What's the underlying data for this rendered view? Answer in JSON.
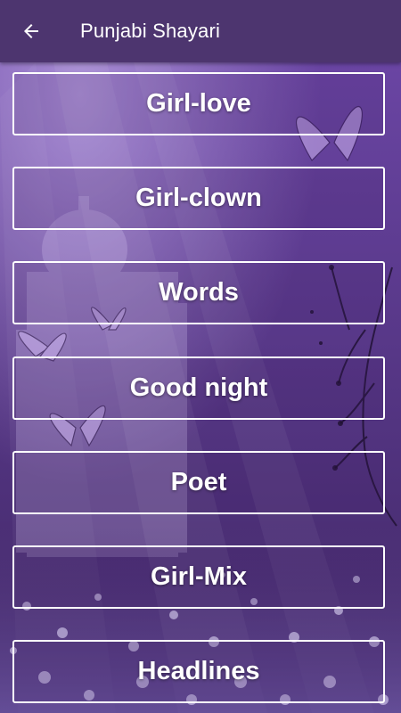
{
  "appbar": {
    "title": "Punjabi Shayari",
    "back_icon": "arrow-left-icon"
  },
  "categories": [
    {
      "label": "Girl-love"
    },
    {
      "label": "Girl-clown"
    },
    {
      "label": "Words"
    },
    {
      "label": "Good night"
    },
    {
      "label": "Poet"
    },
    {
      "label": "Girl-Mix"
    },
    {
      "label": "Headlines"
    }
  ],
  "colors": {
    "appbar": "#4d356f",
    "background": "#5b3a8c",
    "button_border": "#ffffff",
    "text": "#ffffff"
  }
}
